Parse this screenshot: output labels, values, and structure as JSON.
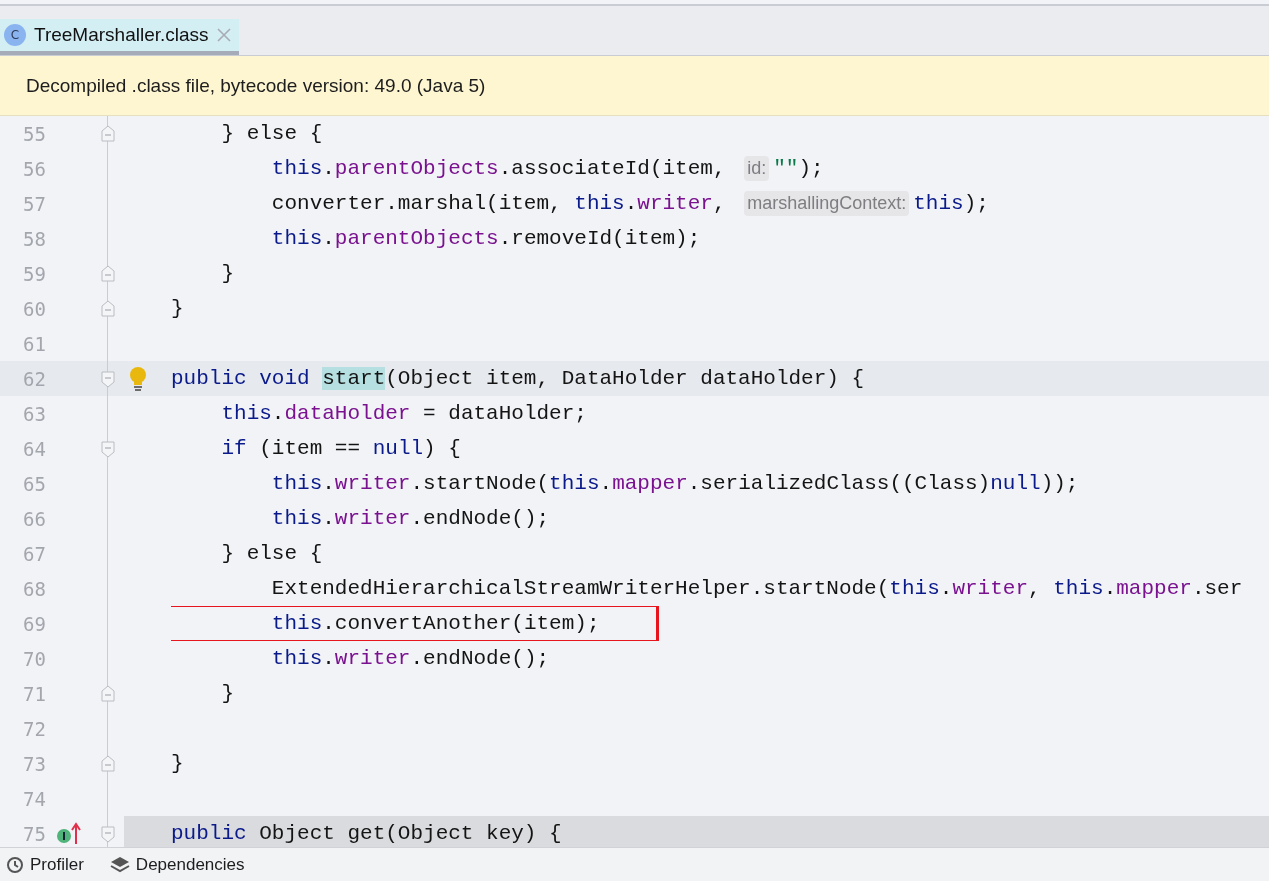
{
  "tab": {
    "icon_letter": "C",
    "title": "TreeMarshaller.class",
    "selected": true
  },
  "banner": {
    "text": "Decompiled .class file, bytecode version: 49.0 (Java 5)"
  },
  "lines": [
    {
      "number": "55",
      "fold_end": true,
      "tokens": [
        {
          "kind": "plain",
          "text": "    } else {"
        }
      ]
    },
    {
      "number": "56",
      "tokens": [
        {
          "kind": "keyword",
          "text": "        this"
        },
        {
          "kind": "plain",
          "text": "."
        },
        {
          "kind": "field",
          "text": "parentObjects"
        },
        {
          "kind": "plain",
          "text": ".associateId(item, "
        },
        {
          "kind": "hint",
          "text": "id:"
        },
        {
          "kind": "string",
          "text": "\"\""
        },
        {
          "kind": "plain",
          "text": ");"
        }
      ]
    },
    {
      "number": "57",
      "tokens": [
        {
          "kind": "plain",
          "text": "        converter.marshal(item, "
        },
        {
          "kind": "keyword",
          "text": "this"
        },
        {
          "kind": "plain",
          "text": "."
        },
        {
          "kind": "field",
          "text": "writer"
        },
        {
          "kind": "plain",
          "text": ", "
        },
        {
          "kind": "hint",
          "text": "marshallingContext:"
        },
        {
          "kind": "keyword",
          "text": "this"
        },
        {
          "kind": "plain",
          "text": ");"
        }
      ]
    },
    {
      "number": "58",
      "tokens": [
        {
          "kind": "keyword",
          "text": "        this"
        },
        {
          "kind": "plain",
          "text": "."
        },
        {
          "kind": "field",
          "text": "parentObjects"
        },
        {
          "kind": "plain",
          "text": ".removeId(item);"
        }
      ]
    },
    {
      "number": "59",
      "fold_end": true,
      "tokens": [
        {
          "kind": "plain",
          "text": "    }"
        }
      ]
    },
    {
      "number": "60",
      "fold_end": true,
      "tokens": [
        {
          "kind": "plain",
          "text": "}"
        }
      ]
    },
    {
      "number": "61"
    },
    {
      "number": "62",
      "fold_start": true,
      "current": true,
      "bulb": true,
      "tokens": [
        {
          "kind": "keyword",
          "text": "public void "
        },
        {
          "kind": "match",
          "text": "start"
        },
        {
          "kind": "plain",
          "text": "(Object item, DataHolder dataHolder) {"
        }
      ]
    },
    {
      "number": "63",
      "tokens": [
        {
          "kind": "keyword",
          "text": "    this"
        },
        {
          "kind": "plain",
          "text": "."
        },
        {
          "kind": "field",
          "text": "dataHolder"
        },
        {
          "kind": "plain",
          "text": " = dataHolder;"
        }
      ]
    },
    {
      "number": "64",
      "fold_start": true,
      "tokens": [
        {
          "kind": "keyword",
          "text": "    if"
        },
        {
          "kind": "plain",
          "text": " (item == "
        },
        {
          "kind": "keyword",
          "text": "null"
        },
        {
          "kind": "plain",
          "text": ") {"
        }
      ]
    },
    {
      "number": "65",
      "tokens": [
        {
          "kind": "keyword",
          "text": "        this"
        },
        {
          "kind": "plain",
          "text": "."
        },
        {
          "kind": "field",
          "text": "writer"
        },
        {
          "kind": "plain",
          "text": ".startNode("
        },
        {
          "kind": "keyword",
          "text": "this"
        },
        {
          "kind": "plain",
          "text": "."
        },
        {
          "kind": "field",
          "text": "mapper"
        },
        {
          "kind": "plain",
          "text": ".serializedClass((Class)"
        },
        {
          "kind": "keyword",
          "text": "null"
        },
        {
          "kind": "plain",
          "text": "));"
        }
      ]
    },
    {
      "number": "66",
      "tokens": [
        {
          "kind": "keyword",
          "text": "        this"
        },
        {
          "kind": "plain",
          "text": "."
        },
        {
          "kind": "field",
          "text": "writer"
        },
        {
          "kind": "plain",
          "text": ".endNode();"
        }
      ]
    },
    {
      "number": "67",
      "tokens": [
        {
          "kind": "plain",
          "text": "    } else {"
        }
      ]
    },
    {
      "number": "68",
      "tokens": [
        {
          "kind": "plain",
          "text": "        ExtendedHierarchicalStreamWriterHelper.startNode("
        },
        {
          "kind": "keyword",
          "text": "this"
        },
        {
          "kind": "plain",
          "text": "."
        },
        {
          "kind": "field",
          "text": "writer"
        },
        {
          "kind": "plain",
          "text": ", "
        },
        {
          "kind": "keyword",
          "text": "this"
        },
        {
          "kind": "plain",
          "text": "."
        },
        {
          "kind": "field",
          "text": "mapper"
        },
        {
          "kind": "plain",
          "text": ".ser"
        }
      ]
    },
    {
      "number": "69",
      "boxed": true,
      "tokens": [
        {
          "kind": "keyword",
          "text": "        this"
        },
        {
          "kind": "plain",
          "text": ".convertAnother(item);"
        }
      ]
    },
    {
      "number": "70",
      "tokens": [
        {
          "kind": "keyword",
          "text": "        this"
        },
        {
          "kind": "plain",
          "text": "."
        },
        {
          "kind": "field",
          "text": "writer"
        },
        {
          "kind": "plain",
          "text": ".endNode();"
        }
      ]
    },
    {
      "number": "71",
      "fold_end": true,
      "tokens": [
        {
          "kind": "plain",
          "text": "    }"
        }
      ]
    },
    {
      "number": "72"
    },
    {
      "number": "73",
      "fold_end": true,
      "tokens": [
        {
          "kind": "plain",
          "text": "}"
        }
      ]
    },
    {
      "number": "74"
    },
    {
      "number": "75",
      "fold_start": true,
      "shaded": true,
      "implements_marker": true,
      "tokens": [
        {
          "kind": "keyword",
          "text": "public "
        },
        {
          "kind": "plain",
          "text": "Object get(Object key) {"
        }
      ]
    }
  ],
  "bottom_tabs": [
    {
      "kind": "profiler",
      "label": "Profiler"
    },
    {
      "kind": "dependencies",
      "label": "Dependencies"
    }
  ]
}
